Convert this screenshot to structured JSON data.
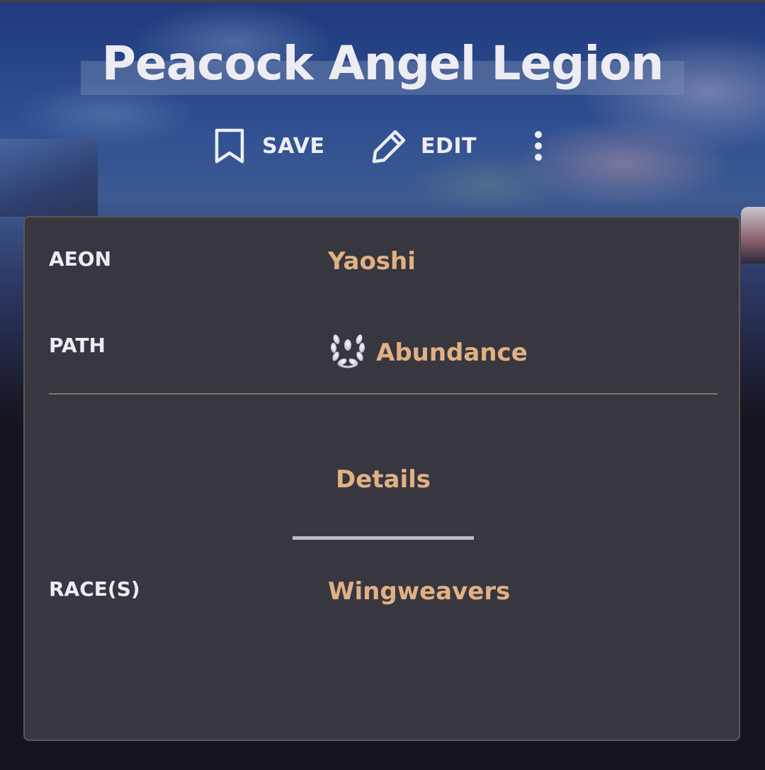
{
  "header": {
    "title": "Peacock Angel Legion"
  },
  "actions": {
    "save_label": "SAVE",
    "edit_label": "EDIT",
    "save_icon": "bookmark-icon",
    "edit_icon": "pencil-icon",
    "more_icon": "more-vertical-icon"
  },
  "infobox": {
    "aeon": {
      "label": "AEON",
      "value": "Yaoshi"
    },
    "path": {
      "label": "PATH",
      "value": "Abundance",
      "icon": "laurel-wreath-icon"
    },
    "section": {
      "label": "Details"
    },
    "races": {
      "label": "RACE(S)",
      "value": "Wingweavers"
    }
  },
  "colors": {
    "accent": "#e0b184",
    "card_background": "#38373f",
    "text_primary": "#ececf2",
    "page_background": "#16151f"
  }
}
